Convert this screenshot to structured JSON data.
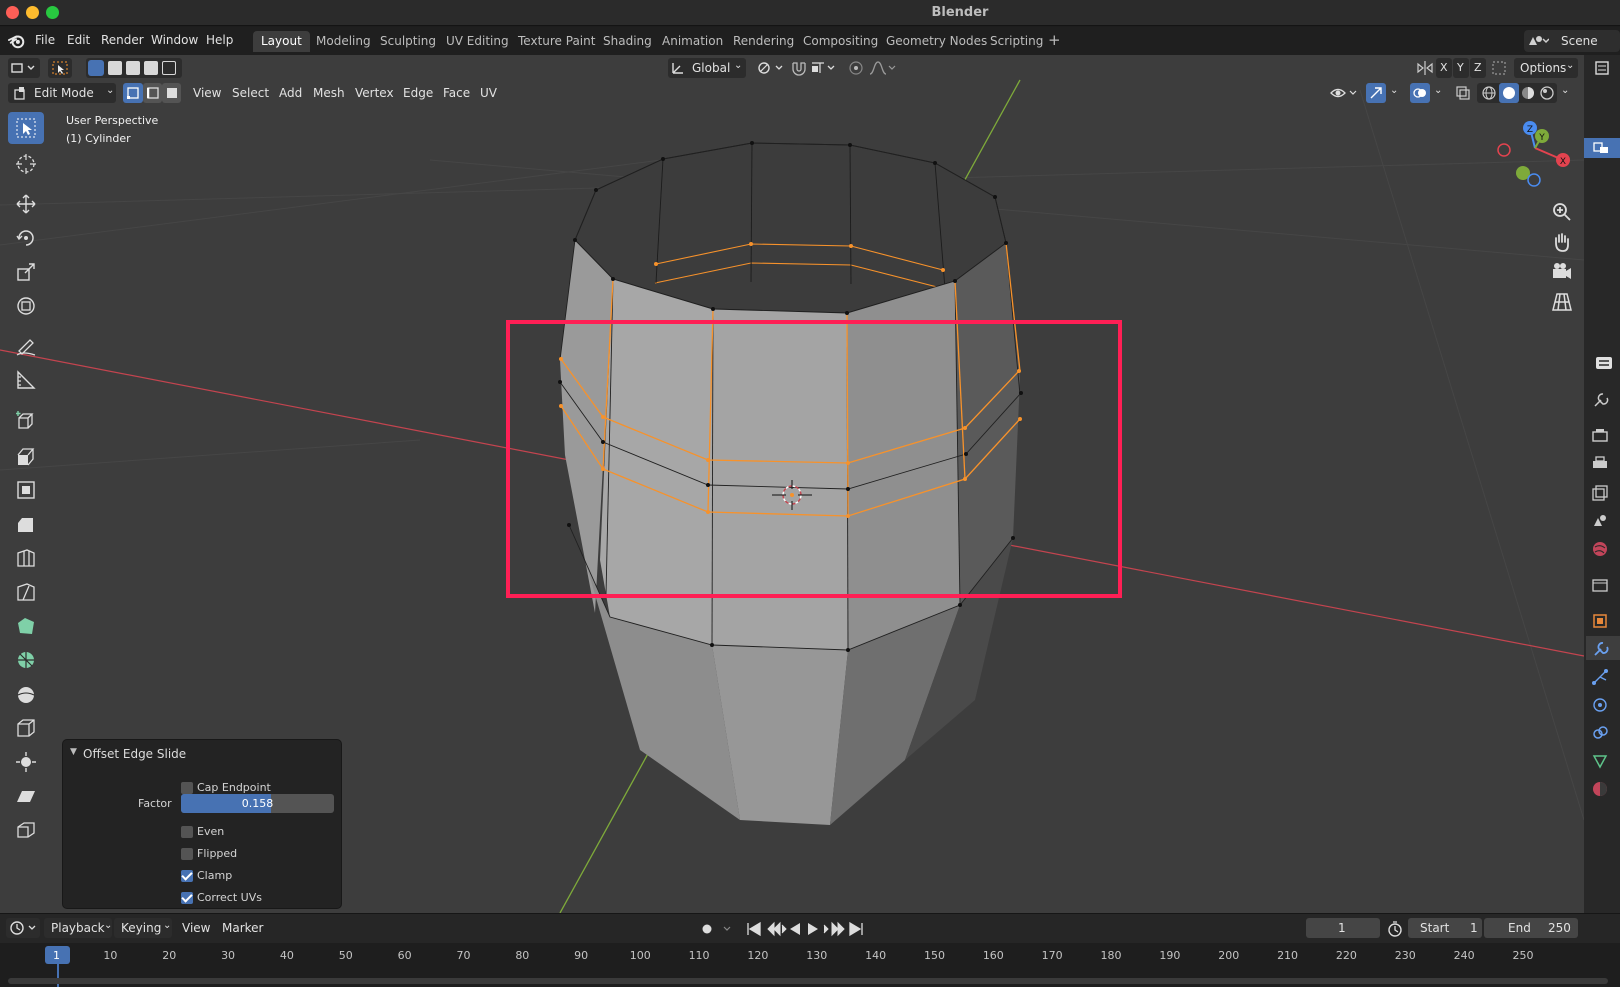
{
  "app": {
    "title": "Blender"
  },
  "menubar": {
    "items": [
      "File",
      "Edit",
      "Render",
      "Window",
      "Help"
    ],
    "workspaces": [
      "Layout",
      "Modeling",
      "Sculpting",
      "UV Editing",
      "Texture Paint",
      "Shading",
      "Animation",
      "Rendering",
      "Compositing",
      "Geometry Nodes",
      "Scripting"
    ],
    "active_workspace": "Layout",
    "add_label": "+",
    "scene": "Scene"
  },
  "viewport_header": {
    "transform_orientation": "Global",
    "axes": [
      "X",
      "Y",
      "Z"
    ],
    "options_label": "Options",
    "mode": "Edit Mode",
    "menus": [
      "View",
      "Select",
      "Add",
      "Mesh",
      "Vertex",
      "Edge",
      "Face",
      "UV"
    ]
  },
  "overlay": {
    "view_name": "User Perspective",
    "object_name": "(1) Cylinder"
  },
  "operator_panel": {
    "title": "Offset Edge Slide",
    "cap_endpoint_label": "Cap Endpoint",
    "cap_endpoint": false,
    "factor_label": "Factor",
    "factor_value": "0.158",
    "factor_fraction": 0.59,
    "even_label": "Even",
    "even": false,
    "flipped_label": "Flipped",
    "flipped": false,
    "clamp_label": "Clamp",
    "clamp": true,
    "correct_uvs_label": "Correct UVs",
    "correct_uvs": true
  },
  "gizmo": {
    "x": "X",
    "y": "Y",
    "z": "Z"
  },
  "timeline": {
    "menus": [
      "Playback",
      "Keying",
      "View",
      "Marker"
    ],
    "current_frame": "1",
    "start_label": "Start",
    "start_value": "1",
    "end_label": "End",
    "end_value": "250",
    "playhead_label": "1",
    "ruler": [
      "10",
      "20",
      "30",
      "40",
      "50",
      "60",
      "70",
      "80",
      "90",
      "100",
      "110",
      "120",
      "130",
      "140",
      "150",
      "160",
      "170",
      "180",
      "190",
      "200",
      "210",
      "220",
      "230",
      "240",
      "250"
    ]
  },
  "colors": {
    "accent": "#4772b3",
    "highlight_box": "#ff1f55",
    "selected_edge": "#f7922b",
    "x_axis": "#c4444f",
    "y_axis": "#7eaa3a"
  }
}
